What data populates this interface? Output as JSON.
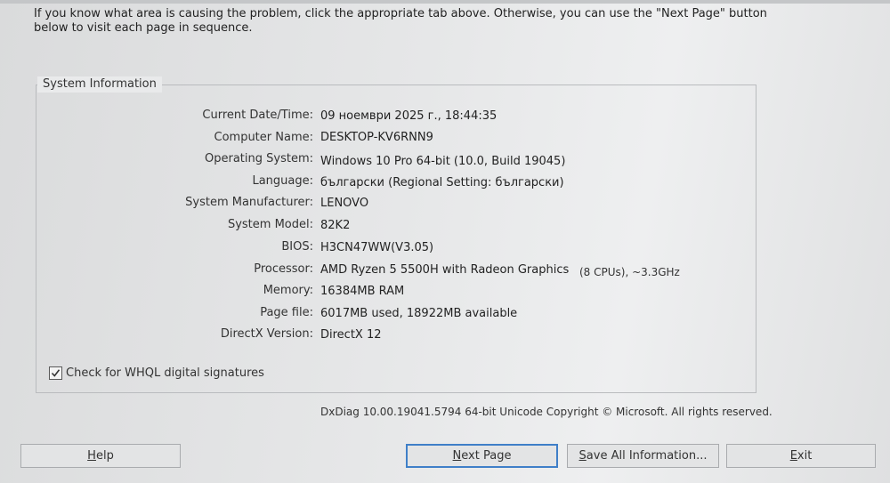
{
  "intro_text": "If you know what area is causing the problem, click the appropriate tab above.  Otherwise, you can use the \"Next Page\" button below to visit each page in sequence.",
  "system_info": {
    "title": "System Information",
    "rows": [
      {
        "label": "Current Date/Time:",
        "value": "09 ноември 2025 г., 18:44:35"
      },
      {
        "label": "Computer Name:",
        "value": "DESKTOP-KV6RNN9"
      },
      {
        "label": "Operating System:",
        "value": "Windows 10 Pro 64-bit (10.0, Build 19045)"
      },
      {
        "label": "Language:",
        "value": "български (Regional Setting: български)"
      },
      {
        "label": "System Manufacturer:",
        "value": "LENOVO"
      },
      {
        "label": "System Model:",
        "value": "82K2"
      },
      {
        "label": "BIOS:",
        "value": "H3CN47WW(V3.05)"
      },
      {
        "label": "Processor:",
        "value": "AMD Ryzen 5 5500H with Radeon Graphics"
      },
      {
        "label": "Memory:",
        "value": "16384MB RAM"
      },
      {
        "label": "Page file:",
        "value": "6017MB used, 18922MB available"
      },
      {
        "label": "DirectX Version:",
        "value": "DirectX 12"
      }
    ],
    "processor_extra": "(8 CPUs), ~3.3GHz",
    "whql_label": "Check for WHQL digital signatures",
    "whql_checked": true
  },
  "copyright": "DxDiag 10.00.19041.5794 64-bit Unicode  Copyright © Microsoft. All rights reserved.",
  "buttons": {
    "help": {
      "first": "H",
      "rest": "elp"
    },
    "next": {
      "first": "N",
      "rest": "ext Page"
    },
    "save": {
      "first": "S",
      "rest": "ave All Information..."
    },
    "exit": {
      "first": "E",
      "rest": "xit"
    }
  }
}
